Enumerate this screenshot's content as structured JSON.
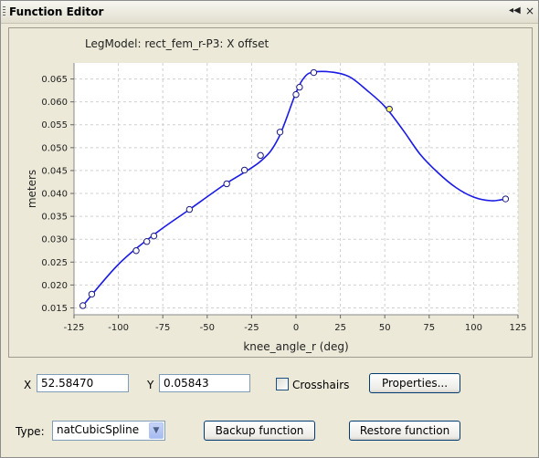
{
  "window": {
    "title": "Function Editor",
    "controls": [
      "◂◀",
      "×"
    ]
  },
  "plot": {
    "title": "LegModel: rect_fem_r-P3: X offset"
  },
  "chart_data": {
    "type": "line",
    "title": "LegModel: rect_fem_r-P3: X offset",
    "xlabel": "knee_angle_r (deg)",
    "ylabel": "meters",
    "xlim": [
      -125,
      125
    ],
    "ylim": [
      0.0135,
      0.0685
    ],
    "xticks": [
      -125,
      -100,
      -75,
      -50,
      -25,
      0,
      25,
      50,
      75,
      100,
      125
    ],
    "xtick_labels": [
      "-125",
      "-100",
      "-75",
      "-50",
      "-25",
      "0",
      "25",
      "50",
      "75",
      "100",
      "125"
    ],
    "yticks": [
      0.015,
      0.02,
      0.025,
      0.03,
      0.035,
      0.04,
      0.045,
      0.05,
      0.055,
      0.06,
      0.065
    ],
    "ytick_labels": [
      "0.015",
      "0.020",
      "0.025",
      "0.030",
      "0.035",
      "0.040",
      "0.045",
      "0.050",
      "0.055",
      "0.060",
      "0.065"
    ],
    "grid": true,
    "curve_color": "#1a1ae6",
    "point_fill": "#ffffff",
    "selected_fill": "#ffff66",
    "curve": {
      "x": [
        -120,
        -100,
        -80,
        -60,
        -40,
        -20,
        -10,
        0,
        5,
        10,
        20,
        30,
        40,
        50,
        60,
        70,
        80,
        90,
        100,
        110,
        118
      ],
      "y": [
        0.0155,
        0.0245,
        0.031,
        0.0365,
        0.042,
        0.047,
        0.052,
        0.062,
        0.0655,
        0.0665,
        0.0665,
        0.0655,
        0.0625,
        0.059,
        0.054,
        0.0485,
        0.0445,
        0.0413,
        0.0392,
        0.0384,
        0.0388
      ]
    },
    "points": {
      "x": [
        -120,
        -115,
        -90,
        -84,
        -80,
        -60,
        -39,
        -29,
        -20,
        -9,
        0,
        2,
        10,
        52.5847,
        118
      ],
      "y": [
        0.0155,
        0.018,
        0.0275,
        0.0295,
        0.0307,
        0.0365,
        0.0421,
        0.0451,
        0.0483,
        0.0534,
        0.0616,
        0.0632,
        0.0664,
        0.05843,
        0.0388
      ]
    },
    "selected_index": 13
  },
  "controls": {
    "x_label": "X",
    "x_value": "52.58470",
    "y_label": "Y",
    "y_value": "0.05843",
    "crosshairs_label": "Crosshairs",
    "crosshairs_checked": false,
    "properties_button": "Properties...",
    "type_label": "Type:",
    "type_value": "natCubicSpline",
    "backup_button": "Backup function",
    "restore_button": "Restore function"
  }
}
